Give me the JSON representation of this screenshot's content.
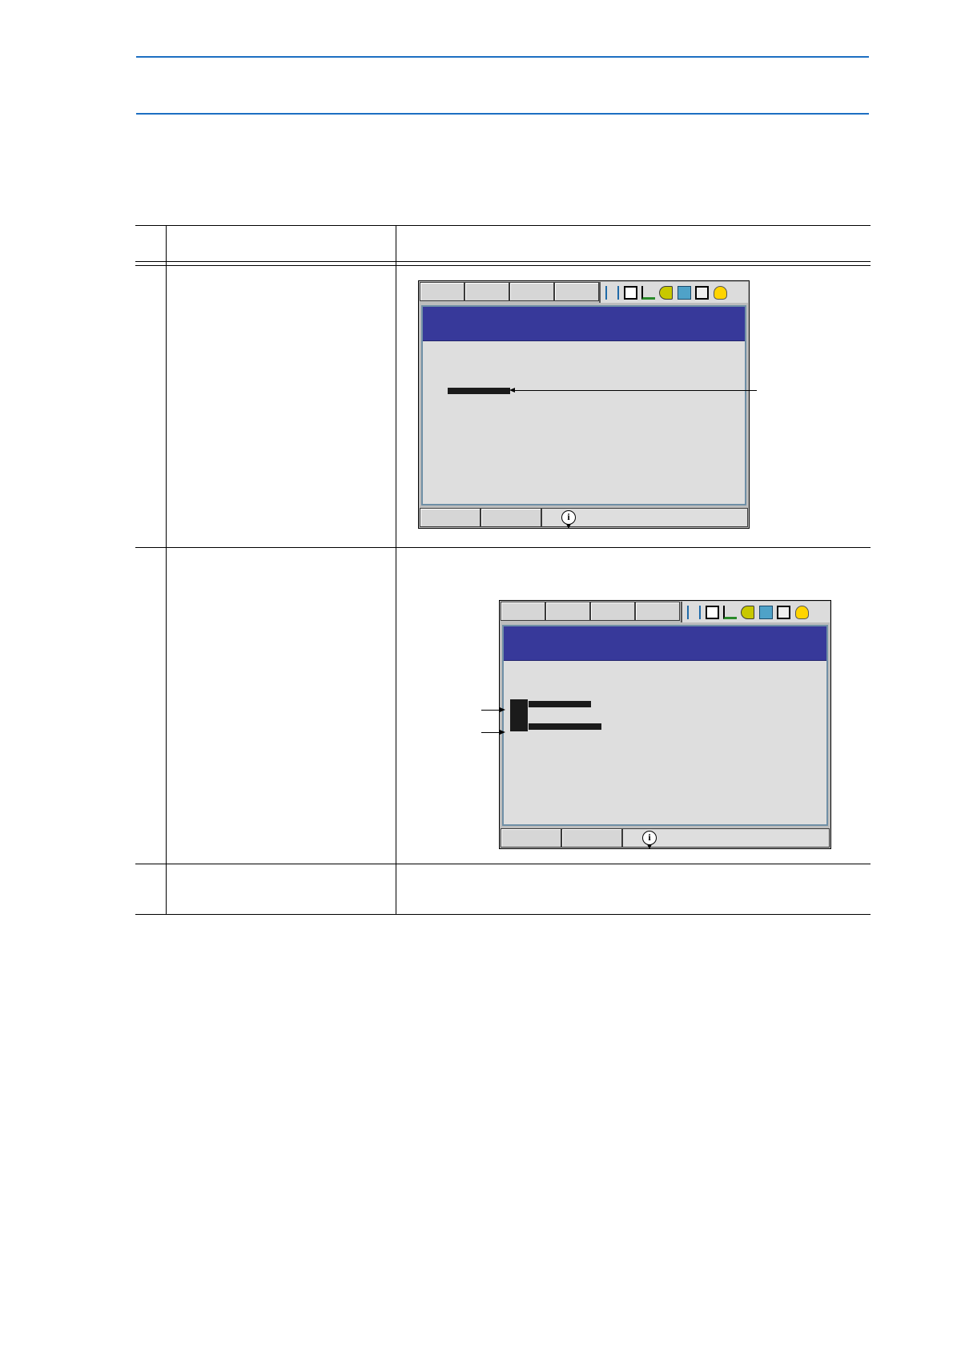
{
  "page": {
    "header_text": "",
    "table_header": {
      "col_no": "",
      "col_operation": "",
      "col_explanation": ""
    }
  },
  "screens": [
    {
      "icons": [
        "cursor-icon",
        "summation-icon",
        "robot-icon",
        "key-icon",
        "grid-icon",
        "edit-icon",
        "lamp-icon"
      ],
      "colors": {
        "titlebar": "#37399a",
        "client": "#dedede",
        "frame": "#bdbdbd"
      }
    },
    {
      "icons": [
        "cursor-icon",
        "summation-icon",
        "robot-icon",
        "key-icon",
        "grid-icon",
        "edit-icon",
        "lamp-icon"
      ],
      "colors": {
        "titlebar": "#37399a",
        "client": "#dedede",
        "frame": "#bdbdbd"
      }
    }
  ]
}
